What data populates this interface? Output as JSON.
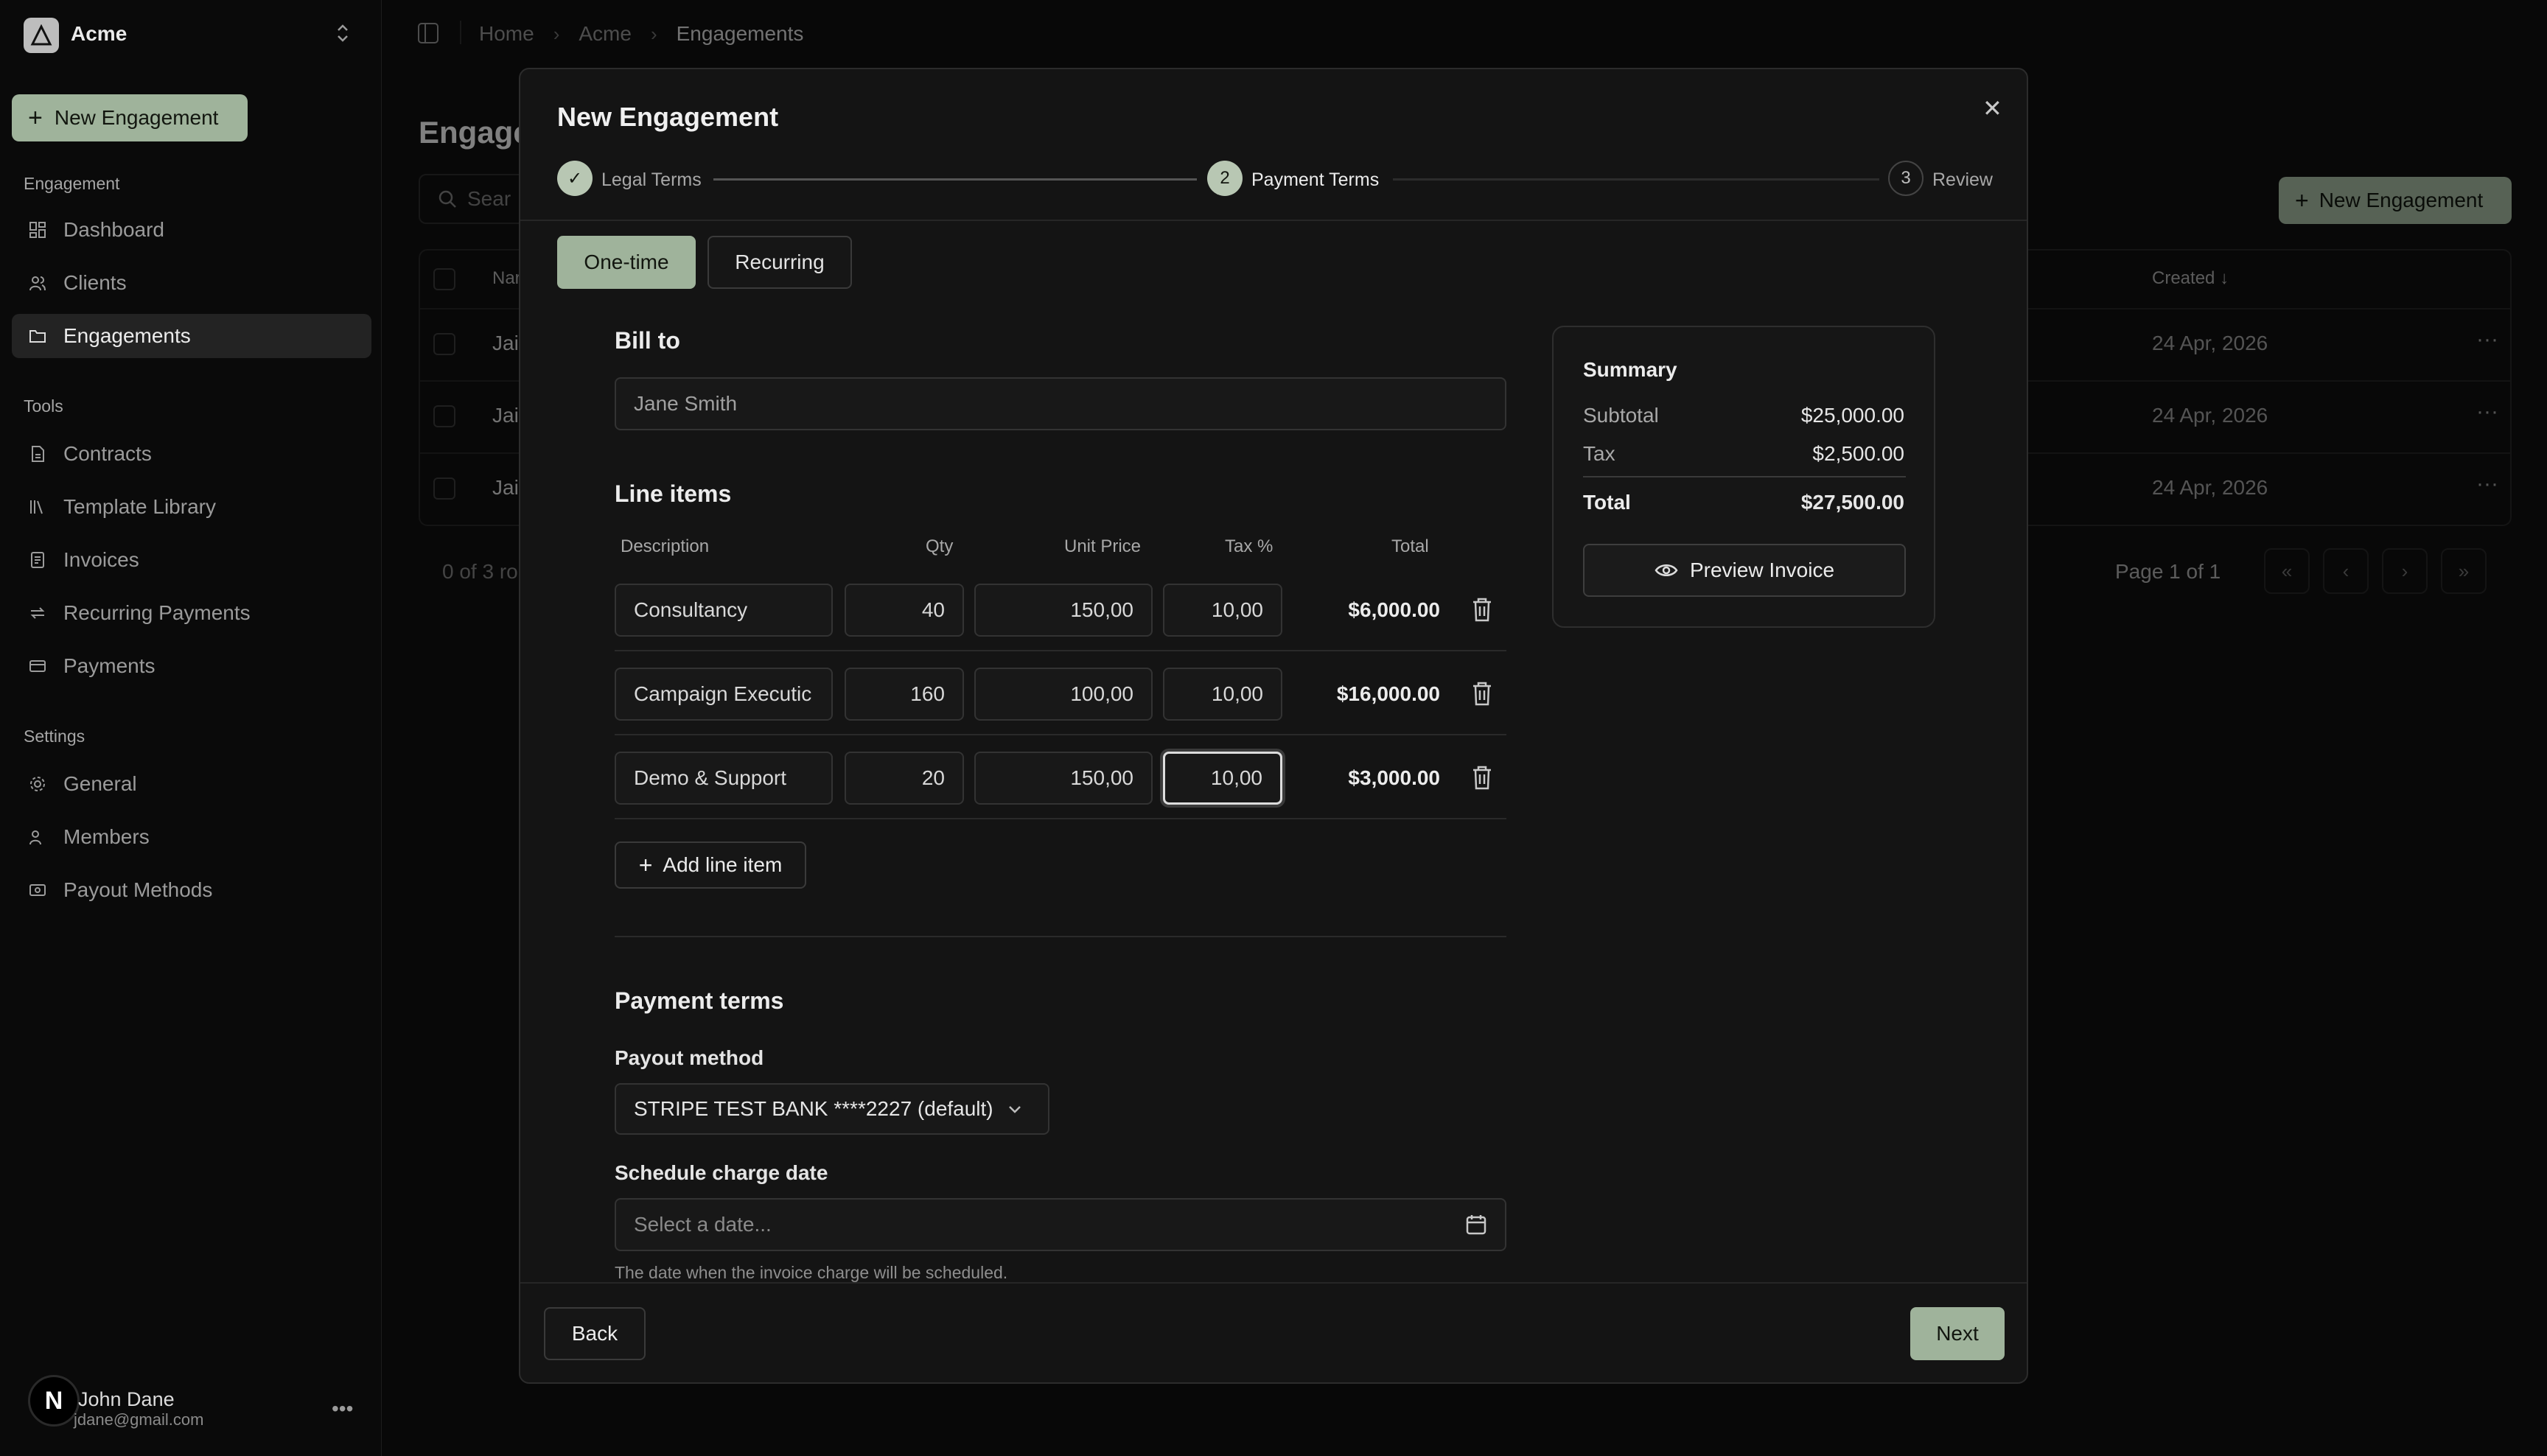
{
  "sidebar": {
    "org_logo_text": "A",
    "org_name": "Acme",
    "new_button": "New Engagement",
    "groups": [
      {
        "label": "Engagement",
        "items": [
          {
            "label": "Dashboard",
            "icon": "dashboard-icon"
          },
          {
            "label": "Clients",
            "icon": "users-icon"
          },
          {
            "label": "Engagements",
            "icon": "folder-icon",
            "active": true
          }
        ]
      },
      {
        "label": "Tools",
        "items": [
          {
            "label": "Contracts",
            "icon": "file-icon"
          },
          {
            "label": "Template Library",
            "icon": "library-icon"
          },
          {
            "label": "Invoices",
            "icon": "invoice-icon"
          },
          {
            "label": "Recurring Payments",
            "icon": "repeat-icon"
          },
          {
            "label": "Payments",
            "icon": "card-icon"
          }
        ]
      },
      {
        "label": "Settings",
        "items": [
          {
            "label": "General",
            "icon": "gear-icon"
          },
          {
            "label": "Members",
            "icon": "users-icon"
          },
          {
            "label": "Payout Methods",
            "icon": "wallet-icon"
          }
        ]
      }
    ],
    "user": {
      "avatar": "N",
      "name": "John Dane",
      "email": "jdane@gmail.com"
    }
  },
  "breadcrumb": [
    "Home",
    "Acme",
    "Engagements"
  ],
  "background": {
    "title": "Engage",
    "search_placeholder": "Sear",
    "new_button": "New Engagement",
    "col_name": "Nar",
    "col_created": "Created",
    "rows": [
      {
        "name": "Jai",
        "created": "24 Apr, 2026"
      },
      {
        "name": "Jai",
        "created": "24 Apr, 2026"
      },
      {
        "name": "Jai",
        "created": "24 Apr, 2026"
      }
    ],
    "count_text": "0 of 3 ro",
    "page_text": "Page 1 of 1"
  },
  "modal": {
    "title": "New Engagement",
    "steps": [
      {
        "num": "✓",
        "label": "Legal Terms",
        "state": "done"
      },
      {
        "num": "2",
        "label": "Payment Terms",
        "state": "current"
      },
      {
        "num": "3",
        "label": "Review",
        "state": "todo"
      }
    ],
    "tabs": [
      "One-time",
      "Recurring"
    ],
    "bill_to_title": "Bill to",
    "bill_to_value": "Jane Smith",
    "line_items_title": "Line items",
    "columns": [
      "Description",
      "Qty",
      "Unit Price",
      "Tax %",
      "Total"
    ],
    "line_items": [
      {
        "description": "Consultancy",
        "qty": "40",
        "unit_price": "150,00",
        "tax": "10,00",
        "total": "$6,000.00"
      },
      {
        "description": "Campaign Executic",
        "qty": "160",
        "unit_price": "100,00",
        "tax": "10,00",
        "total": "$16,000.00"
      },
      {
        "description": "Demo & Support",
        "qty": "20",
        "unit_price": "150,00",
        "tax": "10,00",
        "total": "$3,000.00"
      }
    ],
    "add_line_item": "Add line item",
    "payment_terms_title": "Payment terms",
    "payout_label": "Payout method",
    "payout_value": "STRIPE TEST BANK ****2227 (default)",
    "schedule_label": "Schedule charge date",
    "schedule_placeholder": "Select a date...",
    "schedule_help": "The date when the invoice charge will be scheduled.",
    "summary": {
      "title": "Summary",
      "subtotal_label": "Subtotal",
      "subtotal": "$25,000.00",
      "tax_label": "Tax",
      "tax": "$2,500.00",
      "total_label": "Total",
      "total": "$27,500.00",
      "preview": "Preview Invoice"
    },
    "back": "Back",
    "next": "Next"
  }
}
